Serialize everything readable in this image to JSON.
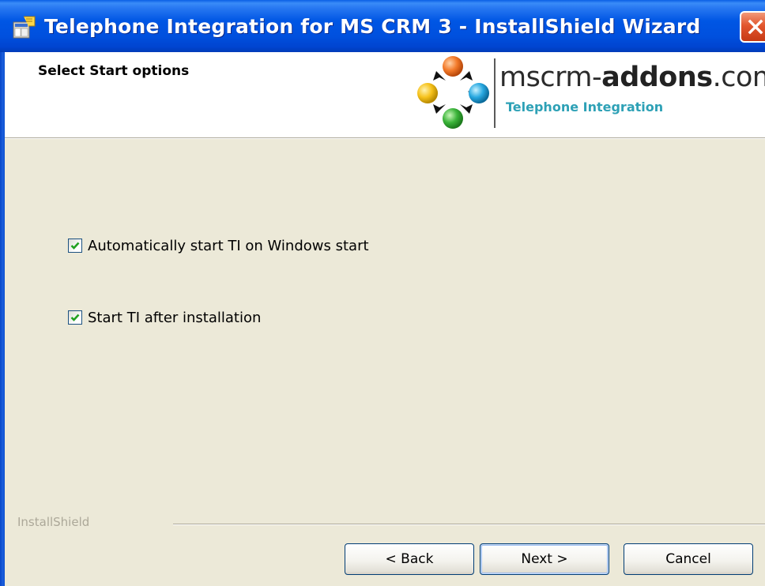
{
  "window": {
    "title": "Telephone Integration for MS CRM 3 - InstallShield Wizard",
    "icon": "installer-package-icon",
    "close_icon": "close-icon"
  },
  "header": {
    "title": "Select Start options",
    "logo": {
      "text_regular": "mscrm-",
      "text_bold": "addons",
      "text_suffix": ".com",
      "subtitle": "Telephone Integration"
    }
  },
  "options": [
    {
      "label": "Automatically start TI on Windows start",
      "checked": true
    },
    {
      "label": "Start TI after installation",
      "checked": true
    }
  ],
  "footer": {
    "brand": "InstallShield",
    "buttons": {
      "back": "< Back",
      "next": "Next >",
      "cancel": "Cancel"
    }
  },
  "colors": {
    "titlebar": "#0054e3",
    "dialog_bg": "#ece9d8",
    "logo_subtitle": "#2ea1b6",
    "close_button": "#e2562e"
  }
}
